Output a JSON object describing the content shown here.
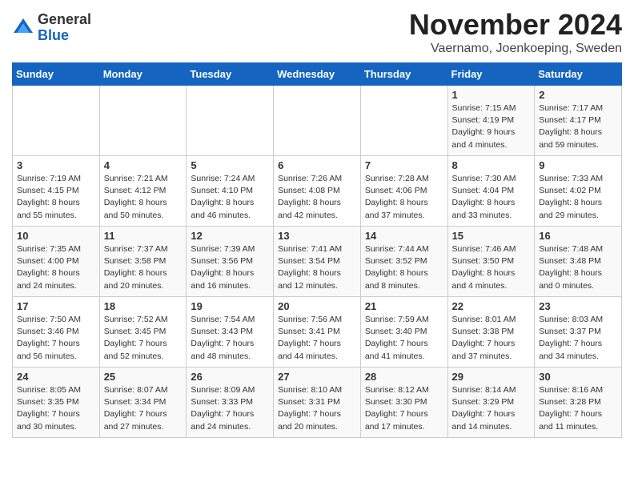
{
  "header": {
    "logo_general": "General",
    "logo_blue": "Blue",
    "month": "November 2024",
    "location": "Vaernamo, Joenkoeping, Sweden"
  },
  "days_of_week": [
    "Sunday",
    "Monday",
    "Tuesday",
    "Wednesday",
    "Thursday",
    "Friday",
    "Saturday"
  ],
  "weeks": [
    [
      {
        "day": "",
        "info": ""
      },
      {
        "day": "",
        "info": ""
      },
      {
        "day": "",
        "info": ""
      },
      {
        "day": "",
        "info": ""
      },
      {
        "day": "",
        "info": ""
      },
      {
        "day": "1",
        "info": "Sunrise: 7:15 AM\nSunset: 4:19 PM\nDaylight: 9 hours\nand 4 minutes."
      },
      {
        "day": "2",
        "info": "Sunrise: 7:17 AM\nSunset: 4:17 PM\nDaylight: 8 hours\nand 59 minutes."
      }
    ],
    [
      {
        "day": "3",
        "info": "Sunrise: 7:19 AM\nSunset: 4:15 PM\nDaylight: 8 hours\nand 55 minutes."
      },
      {
        "day": "4",
        "info": "Sunrise: 7:21 AM\nSunset: 4:12 PM\nDaylight: 8 hours\nand 50 minutes."
      },
      {
        "day": "5",
        "info": "Sunrise: 7:24 AM\nSunset: 4:10 PM\nDaylight: 8 hours\nand 46 minutes."
      },
      {
        "day": "6",
        "info": "Sunrise: 7:26 AM\nSunset: 4:08 PM\nDaylight: 8 hours\nand 42 minutes."
      },
      {
        "day": "7",
        "info": "Sunrise: 7:28 AM\nSunset: 4:06 PM\nDaylight: 8 hours\nand 37 minutes."
      },
      {
        "day": "8",
        "info": "Sunrise: 7:30 AM\nSunset: 4:04 PM\nDaylight: 8 hours\nand 33 minutes."
      },
      {
        "day": "9",
        "info": "Sunrise: 7:33 AM\nSunset: 4:02 PM\nDaylight: 8 hours\nand 29 minutes."
      }
    ],
    [
      {
        "day": "10",
        "info": "Sunrise: 7:35 AM\nSunset: 4:00 PM\nDaylight: 8 hours\nand 24 minutes."
      },
      {
        "day": "11",
        "info": "Sunrise: 7:37 AM\nSunset: 3:58 PM\nDaylight: 8 hours\nand 20 minutes."
      },
      {
        "day": "12",
        "info": "Sunrise: 7:39 AM\nSunset: 3:56 PM\nDaylight: 8 hours\nand 16 minutes."
      },
      {
        "day": "13",
        "info": "Sunrise: 7:41 AM\nSunset: 3:54 PM\nDaylight: 8 hours\nand 12 minutes."
      },
      {
        "day": "14",
        "info": "Sunrise: 7:44 AM\nSunset: 3:52 PM\nDaylight: 8 hours\nand 8 minutes."
      },
      {
        "day": "15",
        "info": "Sunrise: 7:46 AM\nSunset: 3:50 PM\nDaylight: 8 hours\nand 4 minutes."
      },
      {
        "day": "16",
        "info": "Sunrise: 7:48 AM\nSunset: 3:48 PM\nDaylight: 8 hours\nand 0 minutes."
      }
    ],
    [
      {
        "day": "17",
        "info": "Sunrise: 7:50 AM\nSunset: 3:46 PM\nDaylight: 7 hours\nand 56 minutes."
      },
      {
        "day": "18",
        "info": "Sunrise: 7:52 AM\nSunset: 3:45 PM\nDaylight: 7 hours\nand 52 minutes."
      },
      {
        "day": "19",
        "info": "Sunrise: 7:54 AM\nSunset: 3:43 PM\nDaylight: 7 hours\nand 48 minutes."
      },
      {
        "day": "20",
        "info": "Sunrise: 7:56 AM\nSunset: 3:41 PM\nDaylight: 7 hours\nand 44 minutes."
      },
      {
        "day": "21",
        "info": "Sunrise: 7:59 AM\nSunset: 3:40 PM\nDaylight: 7 hours\nand 41 minutes."
      },
      {
        "day": "22",
        "info": "Sunrise: 8:01 AM\nSunset: 3:38 PM\nDaylight: 7 hours\nand 37 minutes."
      },
      {
        "day": "23",
        "info": "Sunrise: 8:03 AM\nSunset: 3:37 PM\nDaylight: 7 hours\nand 34 minutes."
      }
    ],
    [
      {
        "day": "24",
        "info": "Sunrise: 8:05 AM\nSunset: 3:35 PM\nDaylight: 7 hours\nand 30 minutes."
      },
      {
        "day": "25",
        "info": "Sunrise: 8:07 AM\nSunset: 3:34 PM\nDaylight: 7 hours\nand 27 minutes."
      },
      {
        "day": "26",
        "info": "Sunrise: 8:09 AM\nSunset: 3:33 PM\nDaylight: 7 hours\nand 24 minutes."
      },
      {
        "day": "27",
        "info": "Sunrise: 8:10 AM\nSunset: 3:31 PM\nDaylight: 7 hours\nand 20 minutes."
      },
      {
        "day": "28",
        "info": "Sunrise: 8:12 AM\nSunset: 3:30 PM\nDaylight: 7 hours\nand 17 minutes."
      },
      {
        "day": "29",
        "info": "Sunrise: 8:14 AM\nSunset: 3:29 PM\nDaylight: 7 hours\nand 14 minutes."
      },
      {
        "day": "30",
        "info": "Sunrise: 8:16 AM\nSunset: 3:28 PM\nDaylight: 7 hours\nand 11 minutes."
      }
    ]
  ]
}
